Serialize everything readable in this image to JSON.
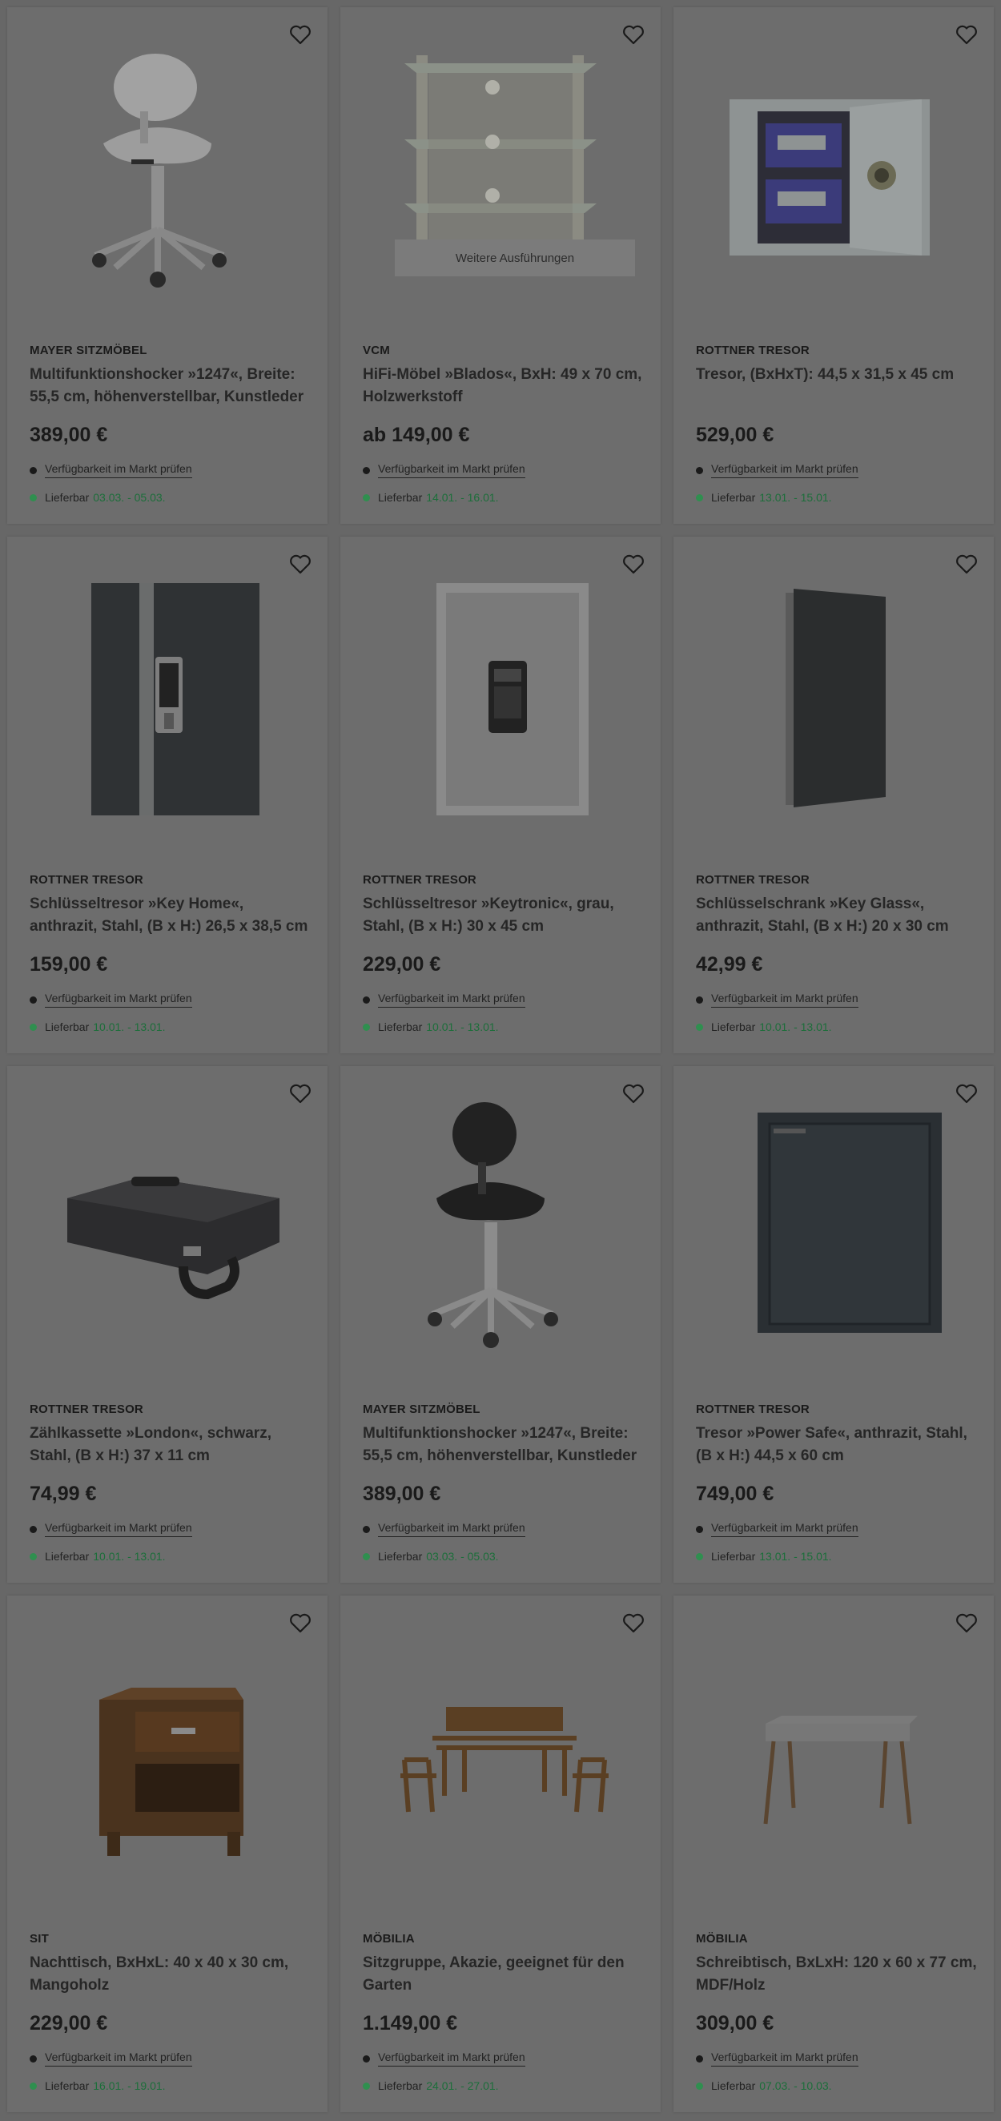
{
  "colors": {
    "overlay": "#676767",
    "delivery_green": "#1c6e3a",
    "delivery_dot": "#2f8f4f"
  },
  "products": [
    {
      "brand": "MAYER SITZMÖBEL",
      "title": "Multifunktionshocker »1247«, Breite: 55,5 cm, höhenverstellbar, Kunstleder",
      "price": "389,00 €",
      "availability": "Verfügbarkeit im Markt prüfen",
      "delivery_label": "Lieferbar",
      "delivery_range": "03.03. - 05.03.",
      "image": "saddle-stool-white",
      "variant_label": ""
    },
    {
      "brand": "VCM",
      "title": "HiFi-Möbel »Blados«, BxH: 49 x 70 cm, Holzwerkstoff",
      "price": "ab 149,00 €",
      "availability": "Verfügbarkeit im Markt prüfen",
      "delivery_label": "Lieferbar",
      "delivery_range": "14.01. - 16.01.",
      "image": "glass-hifi-rack",
      "variant_label": "Weitere Ausführungen"
    },
    {
      "brand": "ROTTNER TRESOR",
      "title": "Tresor, (BxHxT): 44,5 x 31,5 x 45 cm",
      "price": "529,00 €",
      "availability": "Verfügbarkeit im Markt prüfen",
      "delivery_label": "Lieferbar",
      "delivery_range": "13.01. - 15.01.",
      "image": "safe-open-light",
      "variant_label": ""
    },
    {
      "brand": "ROTTNER TRESOR",
      "title": "Schlüsseltresor »Key Home«, anthrazit, Stahl, (B x H:) 26,5 x 38,5 cm",
      "price": "159,00 €",
      "availability": "Verfügbarkeit im Markt prüfen",
      "delivery_label": "Lieferbar",
      "delivery_range": "10.01. - 13.01.",
      "image": "key-safe-anthracite",
      "variant_label": ""
    },
    {
      "brand": "ROTTNER TRESOR",
      "title": "Schlüsseltresor »Keytronic«, grau, Stahl, (B x H:) 30 x 45 cm",
      "price": "229,00 €",
      "availability": "Verfügbarkeit im Markt prüfen",
      "delivery_label": "Lieferbar",
      "delivery_range": "10.01. - 13.01.",
      "image": "key-safe-grey",
      "variant_label": ""
    },
    {
      "brand": "ROTTNER TRESOR",
      "title": "Schlüsselschrank »Key Glass«, anthrazit, Stahl, (B x H:) 20 x 30 cm",
      "price": "42,99 €",
      "availability": "Verfügbarkeit im Markt prüfen",
      "delivery_label": "Lieferbar",
      "delivery_range": "10.01. - 13.01.",
      "image": "key-cabinet-glass",
      "variant_label": ""
    },
    {
      "brand": "ROTTNER TRESOR",
      "title": "Zählkassette »London«, schwarz, Stahl, (B x H:) 37 x 11 cm",
      "price": "74,99 €",
      "availability": "Verfügbarkeit im Markt prüfen",
      "delivery_label": "Lieferbar",
      "delivery_range": "10.01. - 13.01.",
      "image": "cash-box-black",
      "variant_label": ""
    },
    {
      "brand": "MAYER SITZMÖBEL",
      "title": "Multifunktionshocker »1247«, Breite: 55,5 cm, höhenverstellbar, Kunstleder",
      "price": "389,00 €",
      "availability": "Verfügbarkeit im Markt prüfen",
      "delivery_label": "Lieferbar",
      "delivery_range": "03.03. - 05.03.",
      "image": "saddle-stool-black",
      "variant_label": ""
    },
    {
      "brand": "ROTTNER TRESOR",
      "title": "Tresor »Power Safe«, anthrazit, Stahl, (B x H:) 44,5 x 60 cm",
      "price": "749,00 €",
      "availability": "Verfügbarkeit im Markt prüfen",
      "delivery_label": "Lieferbar",
      "delivery_range": "13.01. - 15.01.",
      "image": "power-safe",
      "variant_label": ""
    },
    {
      "brand": "SIT",
      "title": "Nachttisch, BxHxL: 40 x 40 x 30 cm, Mangoholz",
      "price": "229,00 €",
      "availability": "Verfügbarkeit im Markt prüfen",
      "delivery_label": "Lieferbar",
      "delivery_range": "16.01. - 19.01.",
      "image": "nightstand-mango",
      "variant_label": ""
    },
    {
      "brand": "MÖBILIA",
      "title": "Sitzgruppe, Akazie, geeignet für den Garten",
      "price": "1.149,00 €",
      "availability": "Verfügbarkeit im Markt prüfen",
      "delivery_label": "Lieferbar",
      "delivery_range": "24.01. - 27.01.",
      "image": "garden-seating-group",
      "variant_label": ""
    },
    {
      "brand": "MÖBILIA",
      "title": "Schreibtisch, BxLxH: 120 x 60 x 77 cm, MDF/Holz",
      "price": "309,00 €",
      "availability": "Verfügbarkeit im Markt prüfen",
      "delivery_label": "Lieferbar",
      "delivery_range": "07.03. - 10.03.",
      "image": "desk-white-wood",
      "variant_label": ""
    }
  ]
}
